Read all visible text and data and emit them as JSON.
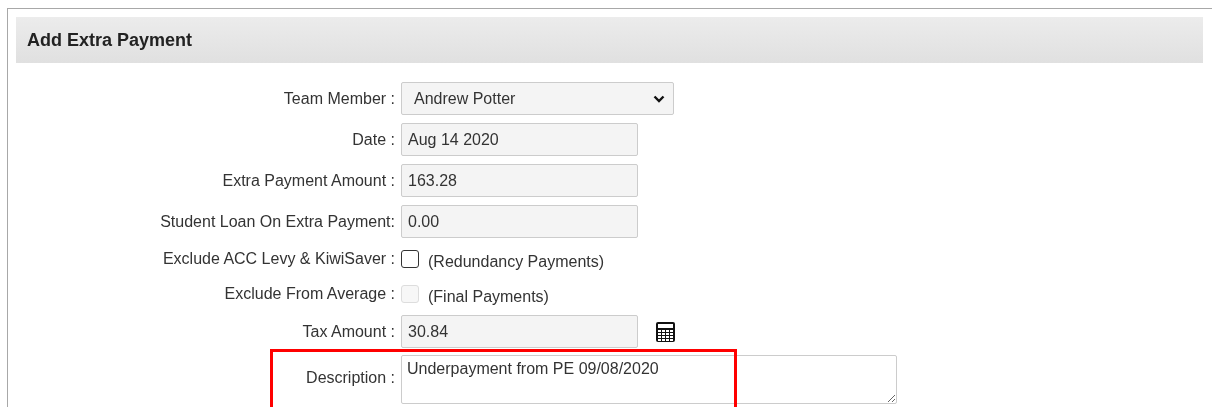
{
  "panel": {
    "title": "Add Extra Payment"
  },
  "fields": [
    {
      "kind": "select",
      "label": "Team Member :",
      "value": "Andrew Potter"
    },
    {
      "kind": "text",
      "label": "Date :",
      "value": "Aug 14 2020"
    },
    {
      "kind": "text",
      "label": "Extra Payment Amount :",
      "value": "163.28"
    },
    {
      "kind": "text",
      "label": "Student Loan On Extra Payment:",
      "value": "0.00"
    },
    {
      "kind": "checkbox",
      "label": "Exclude ACC Levy & KiwiSaver :",
      "note": "(Redundancy Payments)",
      "checked": false,
      "disabled": false
    },
    {
      "kind": "checkbox",
      "label": "Exclude From Average :",
      "note": "(Final Payments)",
      "checked": false,
      "disabled": true
    },
    {
      "kind": "calc",
      "label": "Tax Amount :",
      "value": "30.84"
    },
    {
      "kind": "textarea",
      "label": "Description :",
      "value": "Underpayment from PE 09/08/2020"
    }
  ]
}
